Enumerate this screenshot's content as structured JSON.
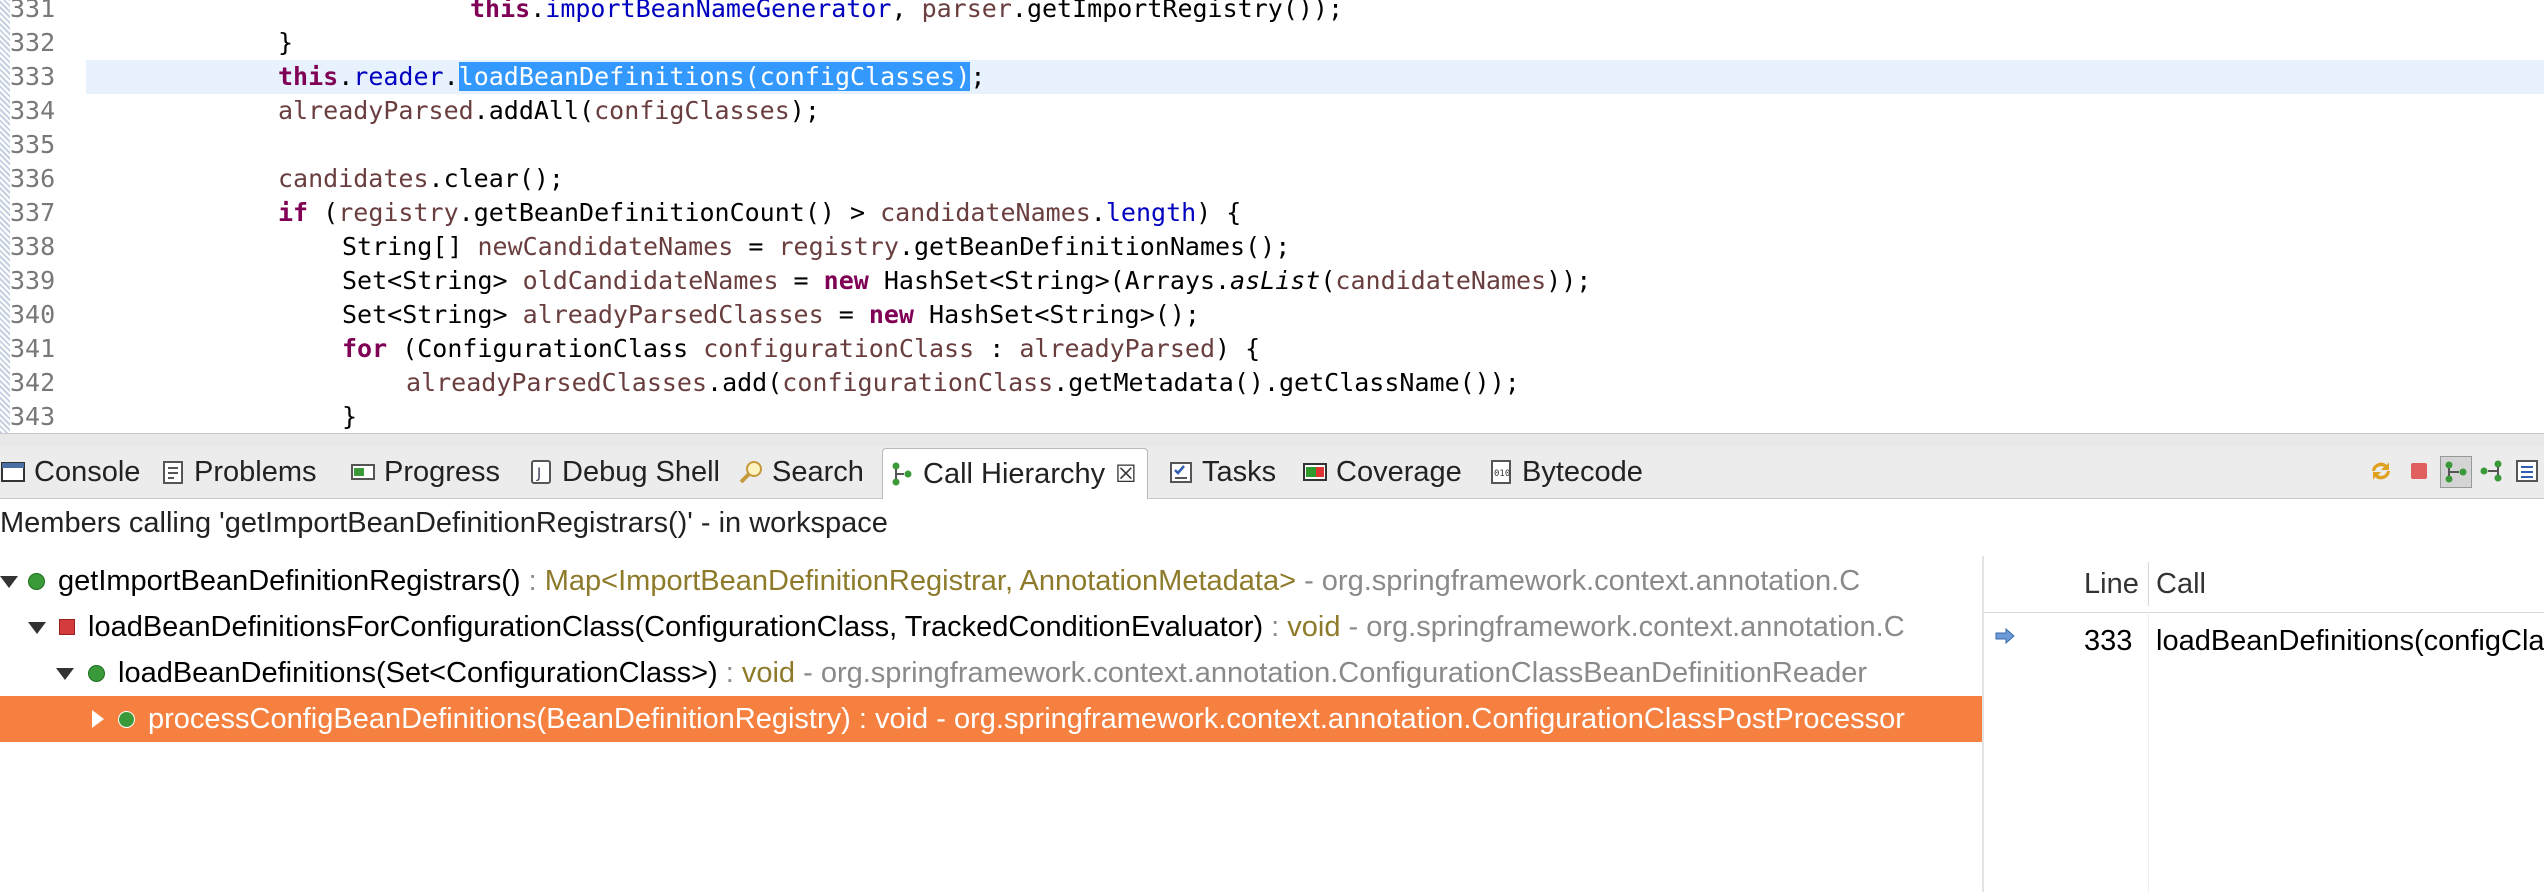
{
  "editor": {
    "lines": [
      {
        "num": "331"
      },
      {
        "num": "332"
      },
      {
        "num": "333"
      },
      {
        "num": "334"
      },
      {
        "num": "335"
      },
      {
        "num": "336"
      },
      {
        "num": "337"
      },
      {
        "num": "338"
      },
      {
        "num": "339"
      },
      {
        "num": "340"
      },
      {
        "num": "341"
      },
      {
        "num": "342"
      },
      {
        "num": "343"
      }
    ],
    "tokens": {
      "this": "this",
      "new": "new",
      "if": "if",
      "for": "for",
      "importBeanNameGenerator": "importBeanNameGenerator",
      "parser": "parser",
      "getImportRegistry": ".getImportRegistry());",
      "close_brace": "}",
      "reader": "reader",
      "loadBeanDefinitions": "loadBeanDefinitions(configClasses)",
      "semicolon": ";",
      "alreadyParsed": "alreadyParsed",
      "addAll": ".addAll(",
      "configClasses": "configClasses",
      "close_paren_semi": ");",
      "candidates": "candidates",
      "clear": ".clear();",
      "registry": "registry",
      "getBeanDefinitionCount": ".getBeanDefinitionCount() > ",
      "candidateNames": "candidateNames",
      "length": "length",
      "paren_brace": ") {",
      "string_arr": "String[] ",
      "newCandidateNames": "newCandidateNames",
      "equals": " = ",
      "getBeanDefinitionNames": ".getBeanDefinitionNames();",
      "set_string": "Set<String> ",
      "oldCandidateNames": "oldCandidateNames",
      "hashset_arrays": " HashSet<String>(Arrays.",
      "asList": "asList",
      "close_two": "));",
      "alreadyParsedClasses": "alreadyParsedClasses",
      "hashset_empty": " HashSet<String>();",
      "configurationClassType": " (ConfigurationClass ",
      "configurationClass": "configurationClass",
      "colon": " : ",
      "add": ".add(",
      "getMetadata": ".getMetadata().getClassName());",
      "dot": ".",
      "open_paren": " ("
    }
  },
  "tabs": [
    {
      "label": "Console"
    },
    {
      "label": "Problems"
    },
    {
      "label": "Progress"
    },
    {
      "label": "Debug Shell"
    },
    {
      "label": "Search"
    },
    {
      "label": "Call Hierarchy"
    },
    {
      "label": "Tasks"
    },
    {
      "label": "Coverage"
    },
    {
      "label": "Bytecode"
    }
  ],
  "tab_close_glyph": "☒",
  "members_label": "Members calling 'getImportBeanDefinitionRegistrars()' - in workspace",
  "tree": [
    {
      "name": "getImportBeanDefinitionRegistrars()",
      "sep1": " : ",
      "type": "Map<ImportBeanDefinitionRegistrar, AnnotationMetadata>",
      "sep2": " - org.springframework.context.annotation.C"
    },
    {
      "name": "loadBeanDefinitionsForConfigurationClass(ConfigurationClass, TrackedConditionEvaluator)",
      "sep1": " : ",
      "type": "void",
      "sep2": " - org.springframework.context.annotation.C"
    },
    {
      "name": "loadBeanDefinitions(Set<ConfigurationClass>)",
      "sep1": " : ",
      "type": "void",
      "sep2": " - org.springframework.context.annotation.ConfigurationClassBeanDefinitionReader"
    },
    {
      "name": "processConfigBeanDefinitions(BeanDefinitionRegistry)",
      "sep1": " : ",
      "type": "void",
      "sep2": " - org.springframework.context.annotation.ConfigurationClassPostProcessor"
    }
  ],
  "table": {
    "headers": {
      "line": "Line",
      "call": "Call"
    },
    "rows": [
      {
        "line": "333",
        "call": "loadBeanDefinitions(configClasses)"
      }
    ]
  }
}
